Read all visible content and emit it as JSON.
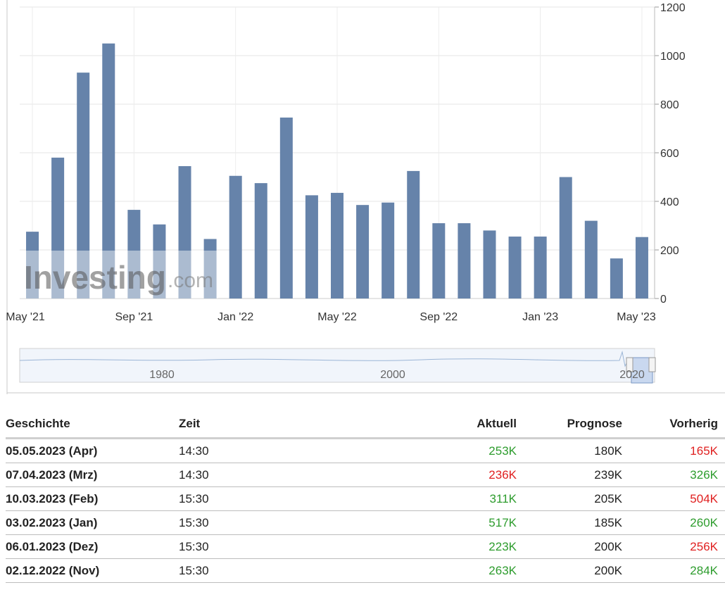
{
  "chart_data": {
    "type": "bar",
    "categories": [
      "May '21",
      "Jun '21",
      "Jul '21",
      "Aug '21",
      "Sep '21",
      "Oct '21",
      "Nov '21",
      "Dec '21",
      "Jan '22",
      "Feb '22",
      "Mar '22",
      "Apr '22",
      "May '22",
      "Jun '22",
      "Jul '22",
      "Aug '22",
      "Sep '22",
      "Oct '22",
      "Nov '22",
      "Dec '22",
      "Jan '23",
      "Feb '23",
      "Mar '23",
      "Apr '23",
      "May '23"
    ],
    "x_tick_labels": [
      "May '21",
      "Sep '21",
      "Jan '22",
      "May '22",
      "Sep '22",
      "Jan '23",
      "May '23"
    ],
    "values": [
      275,
      580,
      930,
      1050,
      365,
      305,
      545,
      245,
      505,
      475,
      745,
      425,
      435,
      385,
      395,
      525,
      310,
      310,
      280,
      255,
      255,
      500,
      320,
      165,
      253
    ],
    "y_ticks": [
      0,
      200,
      400,
      600,
      800,
      1000,
      1200
    ],
    "ylim": [
      0,
      1200
    ],
    "y_axis_position": "right",
    "grid": true,
    "bar_color": "#6683aa",
    "watermark": {
      "brand": "Investing",
      "suffix": ".com"
    },
    "navigator": {
      "labels": [
        "1980",
        "2000",
        "2020"
      ]
    }
  },
  "table": {
    "headers": {
      "date": "Geschichte",
      "time": "Zeit",
      "actual": "Aktuell",
      "forecast": "Prognose",
      "previous": "Vorherig"
    },
    "rows": [
      {
        "date": "05.05.2023 (Apr)",
        "time": "14:30",
        "actual": "253K",
        "actual_color": "green",
        "forecast": "180K",
        "previous": "165K",
        "previous_color": "red"
      },
      {
        "date": "07.04.2023 (Mrz)",
        "time": "14:30",
        "actual": "236K",
        "actual_color": "red",
        "forecast": "239K",
        "previous": "326K",
        "previous_color": "green"
      },
      {
        "date": "10.03.2023 (Feb)",
        "time": "15:30",
        "actual": "311K",
        "actual_color": "green",
        "forecast": "205K",
        "previous": "504K",
        "previous_color": "red"
      },
      {
        "date": "03.02.2023 (Jan)",
        "time": "15:30",
        "actual": "517K",
        "actual_color": "green",
        "forecast": "185K",
        "previous": "260K",
        "previous_color": "green"
      },
      {
        "date": "06.01.2023 (Dez)",
        "time": "15:30",
        "actual": "223K",
        "actual_color": "green",
        "forecast": "200K",
        "previous": "256K",
        "previous_color": "red"
      },
      {
        "date": "02.12.2022 (Nov)",
        "time": "15:30",
        "actual": "263K",
        "actual_color": "green",
        "forecast": "200K",
        "previous": "284K",
        "previous_color": "green"
      }
    ]
  }
}
